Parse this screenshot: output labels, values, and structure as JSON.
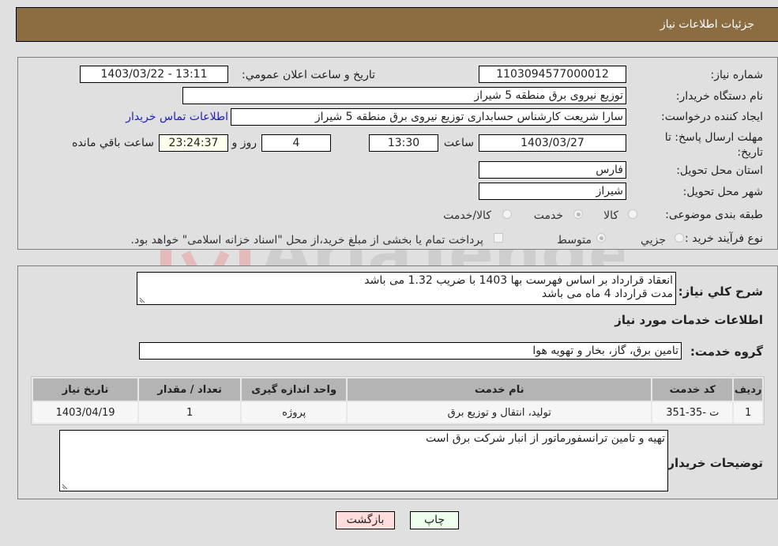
{
  "header": {
    "title": "جزئیات اطلاعات نیاز"
  },
  "form": {
    "need_number": {
      "label": "شماره نیاز:",
      "value": "1103094577000012"
    },
    "announce_datetime": {
      "label": "تاریخ و ساعت اعلان عمومي:",
      "value": "1403/03/22 - 13:11"
    },
    "buyer_org": {
      "label": "نام دستگاه خریدار:",
      "value": "توزیع نیروی برق منطقه 5 شیراز"
    },
    "requester": {
      "label": "ایجاد کننده درخواست:",
      "value": "سارا شریعت کارشناس حسابداری  توزیع نیروی برق منطقه 5 شیراز"
    },
    "contact_link": "اطلاعات تماس خریدار",
    "deadline": {
      "label": "مهلت ارسال پاسخ: تا تاریخ:",
      "date": "1403/03/27",
      "time_label": "ساعت",
      "time": "13:30",
      "days": "4",
      "days_label": "روز و",
      "remaining": "23:24:37",
      "remaining_label": "ساعت باقي مانده"
    },
    "province": {
      "label": "استان محل تحویل:",
      "value": "فارس"
    },
    "city": {
      "label": "شهر محل تحویل:",
      "value": "شیراز"
    },
    "category": {
      "label": "طبقه بندی موضوعی:",
      "options": [
        {
          "label": "کالا",
          "checked": false
        },
        {
          "label": "خدمت",
          "checked": true
        },
        {
          "label": "کالا/خدمت",
          "checked": false
        }
      ]
    },
    "process": {
      "label": "نوع فرآیند خرید :",
      "options": [
        {
          "label": "جزیي",
          "checked": false
        },
        {
          "label": "متوسط",
          "checked": true
        }
      ],
      "treasury_note": "پرداخت تمام یا بخشی از مبلغ خرید،از محل \"اسناد خزانه اسلامی\" خواهد بود."
    }
  },
  "details": {
    "description_label": "شرح کلي نیاز:",
    "description_lines": [
      "انعقاد قرارداد بر اساس فهرست بها 1403 با ضریب 1.32 می باشد",
      " مدت قرارداد 4 ماه می باشد"
    ],
    "services_heading": "اطلاعات خدمات مورد نیاز",
    "service_group_label": "گروه خدمت:",
    "service_group_value": "تامین برق، گاز، بخار و تهویه هوا",
    "table": {
      "headers": [
        "ردیف",
        "کد خدمت",
        "نام خدمت",
        "واحد اندازه گیری",
        "تعداد / مقدار",
        "تاریخ نیاز"
      ],
      "rows": [
        [
          "1",
          "ت -35-351",
          "تولید، انتقال و توزیع برق",
          "پروژه",
          "1",
          "1403/04/19"
        ]
      ]
    },
    "buyer_notes_label": "توضیحات خریدار:",
    "buyer_notes": "تهیه و تامین ترانسفورماتور از انبار شرکت برق است"
  },
  "buttons": {
    "print": "چاپ",
    "back": "بازگشت"
  },
  "watermark": "AriaTender.neT",
  "colors": {
    "header": "#8c6d42",
    "print_bg": "#eeffee",
    "back_bg": "#ffdddd",
    "link": "#2020c0"
  }
}
